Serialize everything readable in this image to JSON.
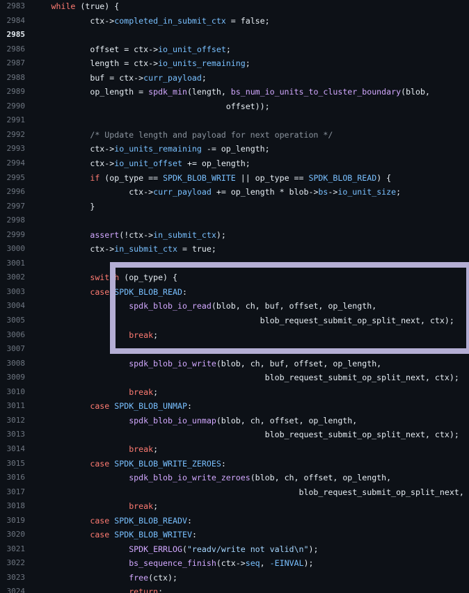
{
  "theme": {
    "background": "#0d1117",
    "keyword": "#ff7b72",
    "function": "#d2a8ff",
    "property": "#79c0ff",
    "string": "#a5d6ff",
    "comment": "#8b949e",
    "text": "#e6edf3",
    "line_number": "#6e7681",
    "highlight_border": "#b4aed4"
  },
  "current_line": "2985",
  "lines": [
    {
      "n": "2983",
      "indent": 1,
      "tokens": [
        [
          "kw",
          "while"
        ],
        [
          "plain",
          " (true) {"
        ]
      ]
    },
    {
      "n": "2984",
      "indent": 2,
      "tokens": [
        [
          "plain",
          "ctx->"
        ],
        [
          "prop",
          "completed_in_submit_ctx"
        ],
        [
          "plain",
          " = false;"
        ]
      ]
    },
    {
      "n": "2985",
      "indent": 0,
      "tokens": []
    },
    {
      "n": "2986",
      "indent": 2,
      "tokens": [
        [
          "plain",
          "offset = ctx->"
        ],
        [
          "prop",
          "io_unit_offset"
        ],
        [
          "plain",
          ";"
        ]
      ]
    },
    {
      "n": "2987",
      "indent": 2,
      "tokens": [
        [
          "plain",
          "length = ctx->"
        ],
        [
          "prop",
          "io_units_remaining"
        ],
        [
          "plain",
          ";"
        ]
      ]
    },
    {
      "n": "2988",
      "indent": 2,
      "tokens": [
        [
          "plain",
          "buf = ctx->"
        ],
        [
          "prop",
          "curr_payload"
        ],
        [
          "plain",
          ";"
        ]
      ]
    },
    {
      "n": "2989",
      "indent": 2,
      "tokens": [
        [
          "plain",
          "op_length = "
        ],
        [
          "fn",
          "spdk_min"
        ],
        [
          "plain",
          "(length, "
        ],
        [
          "fn",
          "bs_num_io_units_to_cluster_boundary"
        ],
        [
          "plain",
          "(blob,"
        ]
      ]
    },
    {
      "n": "2990",
      "indent": 0,
      "pad": "                                    ",
      "tokens": [
        [
          "plain",
          "offset));"
        ]
      ]
    },
    {
      "n": "2991",
      "indent": 0,
      "tokens": []
    },
    {
      "n": "2992",
      "indent": 2,
      "tokens": [
        [
          "comment",
          "/* Update length and payload for next operation */"
        ]
      ]
    },
    {
      "n": "2993",
      "indent": 2,
      "tokens": [
        [
          "plain",
          "ctx->"
        ],
        [
          "prop",
          "io_units_remaining"
        ],
        [
          "plain",
          " -= op_length;"
        ]
      ]
    },
    {
      "n": "2994",
      "indent": 2,
      "tokens": [
        [
          "plain",
          "ctx->"
        ],
        [
          "prop",
          "io_unit_offset"
        ],
        [
          "plain",
          " += op_length;"
        ]
      ]
    },
    {
      "n": "2995",
      "indent": 2,
      "tokens": [
        [
          "kw",
          "if"
        ],
        [
          "plain",
          " (op_type == "
        ],
        [
          "const",
          "SPDK_BLOB_WRITE"
        ],
        [
          "plain",
          " || op_type == "
        ],
        [
          "const",
          "SPDK_BLOB_READ"
        ],
        [
          "plain",
          ") {"
        ]
      ]
    },
    {
      "n": "2996",
      "indent": 3,
      "tokens": [
        [
          "plain",
          "ctx->"
        ],
        [
          "prop",
          "curr_payload"
        ],
        [
          "plain",
          " += op_length * blob->"
        ],
        [
          "prop",
          "bs"
        ],
        [
          "plain",
          "->"
        ],
        [
          "prop",
          "io_unit_size"
        ],
        [
          "plain",
          ";"
        ]
      ]
    },
    {
      "n": "2997",
      "indent": 2,
      "tokens": [
        [
          "plain",
          "}"
        ]
      ]
    },
    {
      "n": "2998",
      "indent": 0,
      "tokens": []
    },
    {
      "n": "2999",
      "indent": 2,
      "tokens": [
        [
          "fn",
          "assert"
        ],
        [
          "plain",
          "(!ctx->"
        ],
        [
          "prop",
          "in_submit_ctx"
        ],
        [
          "plain",
          ");"
        ]
      ]
    },
    {
      "n": "3000",
      "indent": 2,
      "tokens": [
        [
          "plain",
          "ctx->"
        ],
        [
          "prop",
          "in_submit_ctx"
        ],
        [
          "plain",
          " = true;"
        ]
      ]
    },
    {
      "n": "3001",
      "indent": 0,
      "tokens": []
    },
    {
      "n": "3002",
      "indent": 2,
      "tokens": [
        [
          "kw",
          "switch"
        ],
        [
          "plain",
          " (op_type) {"
        ]
      ]
    },
    {
      "n": "3003",
      "indent": 2,
      "tokens": [
        [
          "kw",
          "case"
        ],
        [
          "plain",
          " "
        ],
        [
          "const",
          "SPDK_BLOB_READ"
        ],
        [
          "plain",
          ":"
        ]
      ]
    },
    {
      "n": "3004",
      "indent": 3,
      "tokens": [
        [
          "fn",
          "spdk_blob_io_read"
        ],
        [
          "plain",
          "(blob, ch, buf, offset, op_length,"
        ]
      ]
    },
    {
      "n": "3005",
      "indent": 0,
      "pad": "                                           ",
      "tokens": [
        [
          "plain",
          "blob_request_submit_op_split_next, ctx);"
        ]
      ]
    },
    {
      "n": "3006",
      "indent": 3,
      "tokens": [
        [
          "kw",
          "break"
        ],
        [
          "plain",
          ";"
        ]
      ]
    },
    {
      "n": "3007",
      "indent": 0,
      "tokens": []
    },
    {
      "n": "3008",
      "indent": 3,
      "tokens": [
        [
          "fn",
          "spdk_blob_io_write"
        ],
        [
          "plain",
          "(blob, ch, buf, offset, op_length,"
        ]
      ]
    },
    {
      "n": "3009",
      "indent": 0,
      "pad": "                                            ",
      "tokens": [
        [
          "plain",
          "blob_request_submit_op_split_next, ctx);"
        ]
      ]
    },
    {
      "n": "3010",
      "indent": 3,
      "tokens": [
        [
          "kw",
          "break"
        ],
        [
          "plain",
          ";"
        ]
      ]
    },
    {
      "n": "3011",
      "indent": 2,
      "tokens": [
        [
          "kw",
          "case"
        ],
        [
          "plain",
          " "
        ],
        [
          "const",
          "SPDK_BLOB_UNMAP"
        ],
        [
          "plain",
          ":"
        ]
      ]
    },
    {
      "n": "3012",
      "indent": 3,
      "tokens": [
        [
          "fn",
          "spdk_blob_io_unmap"
        ],
        [
          "plain",
          "(blob, ch, offset, op_length,"
        ]
      ]
    },
    {
      "n": "3013",
      "indent": 0,
      "pad": "                                            ",
      "tokens": [
        [
          "plain",
          "blob_request_submit_op_split_next, ctx);"
        ]
      ]
    },
    {
      "n": "3014",
      "indent": 3,
      "tokens": [
        [
          "kw",
          "break"
        ],
        [
          "plain",
          ";"
        ]
      ]
    },
    {
      "n": "3015",
      "indent": 2,
      "tokens": [
        [
          "kw",
          "case"
        ],
        [
          "plain",
          " "
        ],
        [
          "const",
          "SPDK_BLOB_WRITE_ZEROES"
        ],
        [
          "plain",
          ":"
        ]
      ]
    },
    {
      "n": "3016",
      "indent": 3,
      "tokens": [
        [
          "fn",
          "spdk_blob_io_write_zeroes"
        ],
        [
          "plain",
          "(blob, ch, offset, op_length,"
        ]
      ]
    },
    {
      "n": "3017",
      "indent": 0,
      "pad": "                                                   ",
      "tokens": [
        [
          "plain",
          "blob_request_submit_op_split_next, ctx);"
        ]
      ]
    },
    {
      "n": "3018",
      "indent": 3,
      "tokens": [
        [
          "kw",
          "break"
        ],
        [
          "plain",
          ";"
        ]
      ]
    },
    {
      "n": "3019",
      "indent": 2,
      "tokens": [
        [
          "kw",
          "case"
        ],
        [
          "plain",
          " "
        ],
        [
          "const",
          "SPDK_BLOB_READV"
        ],
        [
          "plain",
          ":"
        ]
      ]
    },
    {
      "n": "3020",
      "indent": 2,
      "tokens": [
        [
          "kw",
          "case"
        ],
        [
          "plain",
          " "
        ],
        [
          "const",
          "SPDK_BLOB_WRITEV"
        ],
        [
          "plain",
          ":"
        ]
      ]
    },
    {
      "n": "3021",
      "indent": 3,
      "tokens": [
        [
          "fn",
          "SPDK_ERRLOG"
        ],
        [
          "plain",
          "("
        ],
        [
          "str",
          "\"readv/write not valid\\n\""
        ],
        [
          "plain",
          ");"
        ]
      ]
    },
    {
      "n": "3022",
      "indent": 3,
      "tokens": [
        [
          "fn",
          "bs_sequence_finish"
        ],
        [
          "plain",
          "(ctx->"
        ],
        [
          "prop",
          "seq"
        ],
        [
          "plain",
          ", "
        ],
        [
          "op",
          "-"
        ],
        [
          "const",
          "EINVAL"
        ],
        [
          "plain",
          ");"
        ]
      ]
    },
    {
      "n": "3023",
      "indent": 3,
      "tokens": [
        [
          "fn",
          "free"
        ],
        [
          "plain",
          "(ctx);"
        ]
      ]
    },
    {
      "n": "3024",
      "indent": 3,
      "tokens": [
        [
          "kw",
          "return"
        ],
        [
          "plain",
          ";"
        ]
      ]
    }
  ]
}
